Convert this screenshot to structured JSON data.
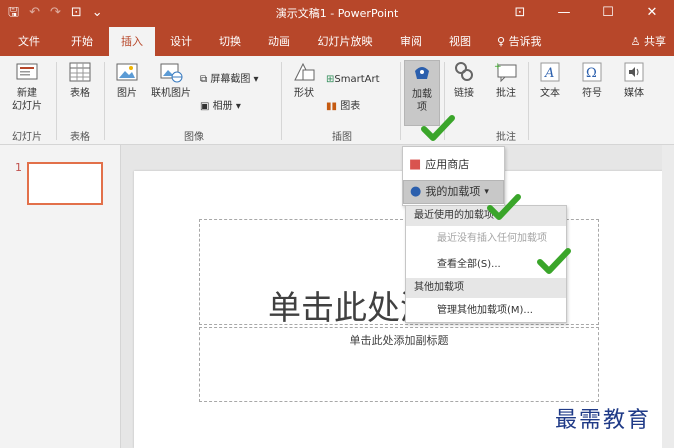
{
  "window": {
    "title": "演示文稿1 - PowerPoint",
    "controls": [
      "⊡",
      "—",
      "☐",
      "✕"
    ]
  },
  "qat": {
    "save": "🖫",
    "undo": "↶",
    "redo": "↷",
    "present": "⊡",
    "more": "⌄"
  },
  "tabs": [
    "文件",
    "开始",
    "插入",
    "设计",
    "切换",
    "动画",
    "幻灯片放映",
    "审阅",
    "视图"
  ],
  "active_tab": "插入",
  "tell_me": "告诉我",
  "share": "共享",
  "ribbon": {
    "slides_group": {
      "new_slide": "新建\n幻灯片",
      "label": "幻灯片"
    },
    "tables_group": {
      "table": "表格",
      "label": "表格"
    },
    "images_group": {
      "pictures": "图片",
      "online_pictures": "联机图片",
      "screenshot": "屏幕截图",
      "album": "相册",
      "label": "图像"
    },
    "illustrations_group": {
      "shapes": "形状",
      "smartart": "SmartArt",
      "chart": "图表",
      "label": "插图"
    },
    "addins_group": {
      "addins": "加载\n项"
    },
    "links_group": {
      "link": "链接",
      "comment": "批注",
      "label": "批注"
    },
    "text_group": {
      "text": "文本"
    },
    "symbols_group": {
      "symbols": "符号"
    },
    "media_group": {
      "media": "媒体"
    }
  },
  "dropdown": {
    "store": "应用商店",
    "my_addins": "我的加载项"
  },
  "submenu": {
    "recent_header": "最近使用的加载项",
    "none_inserted": "最近没有插入任何加载项",
    "view_all": "查看全部(S)...",
    "other_header": "其他加载项",
    "manage_other": "管理其他加载项(M)..."
  },
  "slide_panel": {
    "number": "1"
  },
  "slide": {
    "title_placeholder": "单击此处添加标题",
    "subtitle_placeholder": "单击此处添加副标题"
  },
  "watermark": "最需教育",
  "colors": {
    "accent": "#b7472a",
    "check": "#3aa52a",
    "watermark": "#1f3a87"
  }
}
